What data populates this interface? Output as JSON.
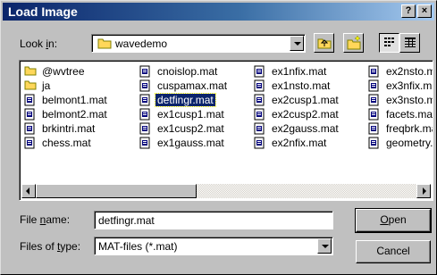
{
  "window": {
    "title": "Load Image",
    "help_label": "?",
    "close_label": "×"
  },
  "look_in": {
    "label_pre": "Look ",
    "label_key": "i",
    "label_post": "n:",
    "value": "wavedemo"
  },
  "toolbar": {
    "up_icon": "up-folder-icon",
    "new_folder_icon": "new-folder-icon",
    "list_icon": "list-view-icon",
    "details_icon": "details-view-icon"
  },
  "files": {
    "columns": [
      [
        {
          "name": "@wvtree",
          "type": "folder"
        },
        {
          "name": "ja",
          "type": "folder"
        },
        {
          "name": "belmont1.mat",
          "type": "file"
        },
        {
          "name": "belmont2.mat",
          "type": "file"
        },
        {
          "name": "brkintri.mat",
          "type": "file"
        },
        {
          "name": "chess.mat",
          "type": "file"
        }
      ],
      [
        {
          "name": "cnoislop.mat",
          "type": "file"
        },
        {
          "name": "cuspamax.mat",
          "type": "file"
        },
        {
          "name": "detfingr.mat",
          "type": "file",
          "selected": true
        },
        {
          "name": "ex1cusp1.mat",
          "type": "file"
        },
        {
          "name": "ex1cusp2.mat",
          "type": "file"
        },
        {
          "name": "ex1gauss.mat",
          "type": "file"
        }
      ],
      [
        {
          "name": "ex1nfix.mat",
          "type": "file"
        },
        {
          "name": "ex1nsto.mat",
          "type": "file"
        },
        {
          "name": "ex2cusp1.mat",
          "type": "file"
        },
        {
          "name": "ex2cusp2.mat",
          "type": "file"
        },
        {
          "name": "ex2gauss.mat",
          "type": "file"
        },
        {
          "name": "ex2nfix.mat",
          "type": "file"
        }
      ],
      [
        {
          "name": "ex2nsto.ma",
          "type": "file"
        },
        {
          "name": "ex3nfix.ma",
          "type": "file"
        },
        {
          "name": "ex3nsto.ma",
          "type": "file"
        },
        {
          "name": "facets.mat",
          "type": "file"
        },
        {
          "name": "freqbrk.ma",
          "type": "file"
        },
        {
          "name": "geometry.r",
          "type": "file"
        }
      ]
    ]
  },
  "file_name": {
    "label_pre": "File ",
    "label_key": "n",
    "label_post": "ame:",
    "value": "detfingr.mat"
  },
  "file_type": {
    "label_pre": "Files of ",
    "label_key": "t",
    "label_post": "ype:",
    "value": "MAT-files (*.mat)"
  },
  "buttons": {
    "open_key": "O",
    "open_rest": "pen",
    "cancel": "Cancel"
  },
  "colors": {
    "title_start": "#0a246a",
    "title_end": "#a6caf0",
    "face": "#c0c0c0",
    "selection": "#0a246a",
    "folder": "#ffd75a",
    "file_icon": "#00007b"
  }
}
